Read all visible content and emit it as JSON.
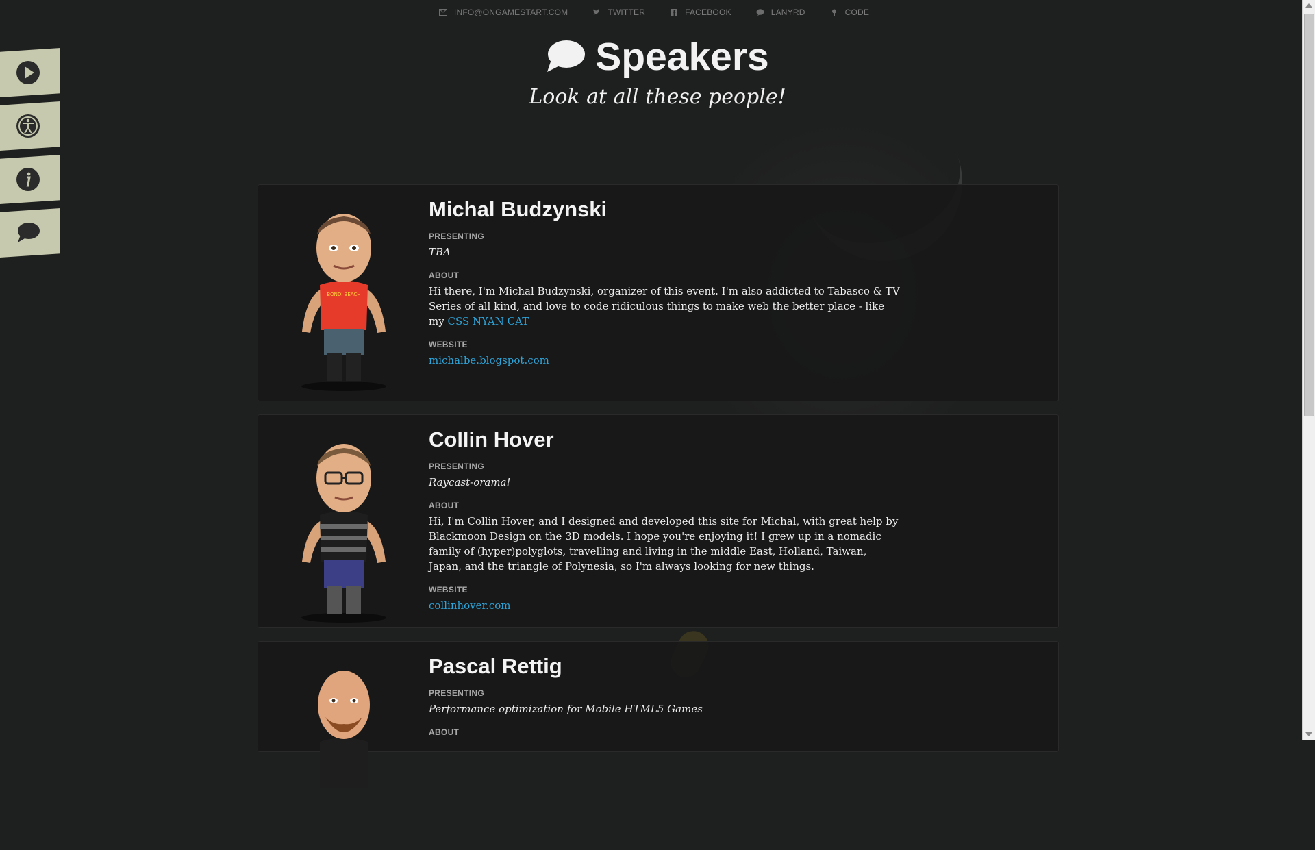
{
  "nav": [
    {
      "label": "INFO@ONGAMESTART.COM",
      "icon": "mail-icon"
    },
    {
      "label": "TWITTER",
      "icon": "twitter-icon"
    },
    {
      "label": "FACEBOOK",
      "icon": "facebook-icon"
    },
    {
      "label": "LANYRD",
      "icon": "lanyrd-icon"
    },
    {
      "label": "CODE",
      "icon": "code-icon"
    }
  ],
  "header": {
    "title": "Speakers",
    "subtitle": "Look at all these people!"
  },
  "sidebar": [
    "play-icon",
    "accessibility-icon",
    "info-icon",
    "speech-bubble-icon"
  ],
  "labels": {
    "presenting": "PRESENTING",
    "about": "ABOUT",
    "website": "WEBSITE"
  },
  "speakers": [
    {
      "name": "Michal Budzynski",
      "presenting": "TBA",
      "about": "Hi there, I'm Michal Budzynski, organizer of this event. I'm also addicted to Tabasco & TV Series of all kind, and love to code ridiculous things to make web the better place - like my",
      "about_link": "CSS NYAN CAT",
      "website": "michalbe.blogspot.com",
      "shirt": "BONDI BEACH"
    },
    {
      "name": "Collin Hover",
      "presenting": "Raycast-orama!",
      "about": "Hi, I'm Collin Hover, and I designed and developed this site for Michal, with great help by Blackmoon Design on the 3D models. I hope you're enjoying it! I grew up in a nomadic family of (hyper)polyglots, travelling and living in the middle East, Holland, Taiwan, Japan, and the triangle of Polynesia, so I'm always looking for new things.",
      "website": "collinhover.com"
    },
    {
      "name": "Pascal Rettig",
      "presenting": "Performance optimization for Mobile HTML5 Games"
    }
  ],
  "colors": {
    "background": "#1e1f1f",
    "card": "#181818",
    "link": "#2ea3d8",
    "tab": "#c6c9ad"
  }
}
